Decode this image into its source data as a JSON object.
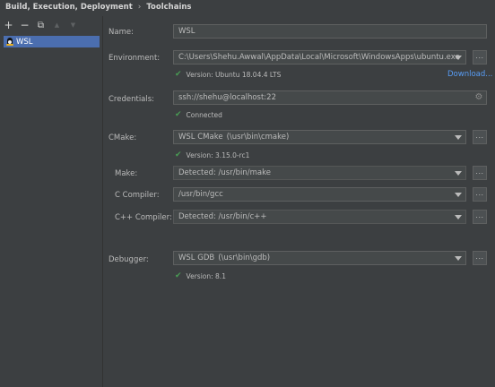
{
  "breadcrumb": {
    "parent": "Build, Execution, Deployment",
    "separator": "›",
    "current": "Toolchains"
  },
  "toolbar": {
    "add": "+",
    "remove": "−",
    "copy": "⧉",
    "up": "▲",
    "down": "▼"
  },
  "toolchains": [
    {
      "label": "WSL"
    }
  ],
  "form": {
    "name_label": "Name:",
    "name_value": "WSL",
    "environment_label": "Environment:",
    "environment_value": "C:\\Users\\Shehu.Awwal\\AppData\\Local\\Microsoft\\WindowsApps\\ubuntu.exe",
    "environment_status": "Version: Ubuntu 18.04.4 LTS",
    "download_link": "Download...",
    "credentials_label": "Credentials:",
    "credentials_value": "ssh://shehu@localhost:22",
    "credentials_status": "Connected",
    "cmake_label": "CMake:",
    "cmake_value": "WSL CMake",
    "cmake_path": "(\\usr\\bin\\cmake)",
    "cmake_status": "Version: 3.15.0-rc1",
    "make_label": "Make:",
    "make_placeholder": "Detected: /usr/bin/make",
    "c_compiler_label": "C Compiler:",
    "c_compiler_value": "/usr/bin/gcc",
    "cpp_compiler_label": "C++ Compiler:",
    "cpp_compiler_placeholder": "Detected: /usr/bin/c++",
    "debugger_label": "Debugger:",
    "debugger_value": "WSL GDB",
    "debugger_path": "(\\usr\\bin\\gdb)",
    "debugger_status": "Version: 8.1",
    "browse_label": "...",
    "check_glyph": "✔",
    "gear_glyph": "⚙"
  },
  "colors": {
    "background": "#3c3f41",
    "selection": "#4b6eaf",
    "success": "#499c54",
    "link": "#589df6"
  }
}
